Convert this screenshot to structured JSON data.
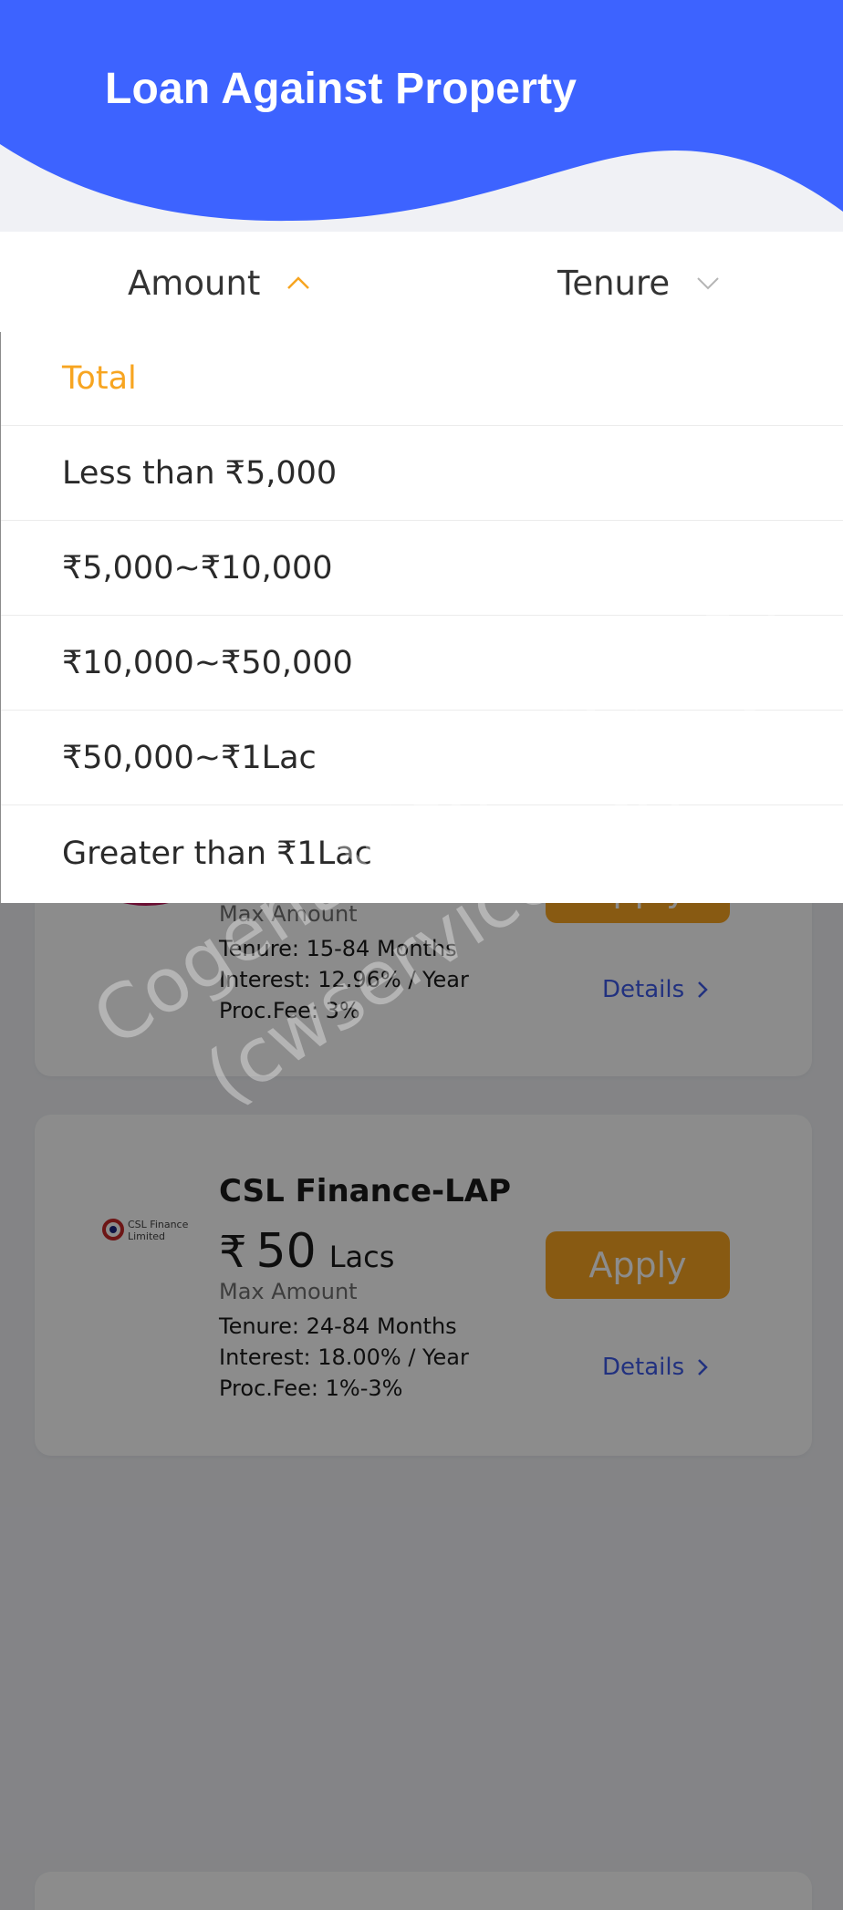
{
  "header": {
    "title": "Loan Against Property",
    "color": "#3d63ff"
  },
  "filters": {
    "amount_label": "Amount",
    "amount_icon": "chevron-up-icon",
    "amount_state": "open",
    "tenure_label": "Tenure",
    "tenure_icon": "chevron-down-icon",
    "active_color": "#f7a521"
  },
  "dropdown": {
    "items": [
      {
        "label": "Total",
        "selected": true
      },
      {
        "label": "Less than ₹5,000",
        "selected": false
      },
      {
        "label": "₹5,000~₹10,000",
        "selected": false
      },
      {
        "label": "₹10,000~₹50,000",
        "selected": false
      },
      {
        "label": "₹50,000~₹1Lac",
        "selected": false
      },
      {
        "label": "Greater than ₹1Lac",
        "selected": false
      }
    ]
  },
  "loans": [
    {
      "max_label": "Max Amount",
      "tenure": "Tenure: 15-84 Months",
      "interest": "Interest: 12.96% / Year",
      "proc_fee": "Proc.Fee: 3%",
      "apply_label": "Apply",
      "details_label": "Details"
    },
    {
      "name": "CSL Finance-LAP",
      "logo_text_1": "CSL Finance",
      "logo_text_2": "Limited",
      "currency": "₹",
      "amount": "50",
      "unit": "Lacs",
      "max_label": "Max Amount",
      "tenure": "Tenure: 24-84 Months",
      "interest": "Interest: 18.00% / Year",
      "proc_fee": "Proc.Fee: 1%-3%",
      "apply_label": "Apply",
      "details_label": "Details"
    }
  ],
  "watermark": {
    "line1": "Cogent Web Services",
    "line2": "(cwservices.co.in)"
  },
  "colors": {
    "primary": "#3d63ff",
    "accent": "#f7a521",
    "link": "#3d59e8"
  }
}
